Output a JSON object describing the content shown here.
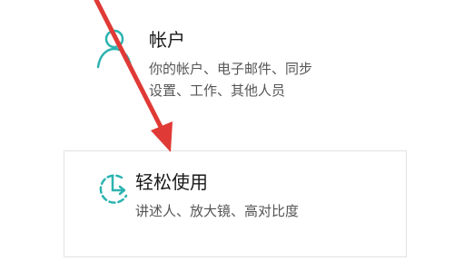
{
  "tiles": {
    "accounts": {
      "icon": "person-icon",
      "title": "帐户",
      "desc_lines": [
        "你的帐户、电子邮件、同步",
        "设置、工作、其他人员"
      ]
    },
    "ease_of_access": {
      "icon": "ease-of-access-icon",
      "title": "轻松使用",
      "desc_lines": [
        "讲述人、放大镜、高对比度"
      ]
    }
  },
  "colors": {
    "icon_accent": "#2bb3b0",
    "annotation_arrow": "#e03a36"
  }
}
